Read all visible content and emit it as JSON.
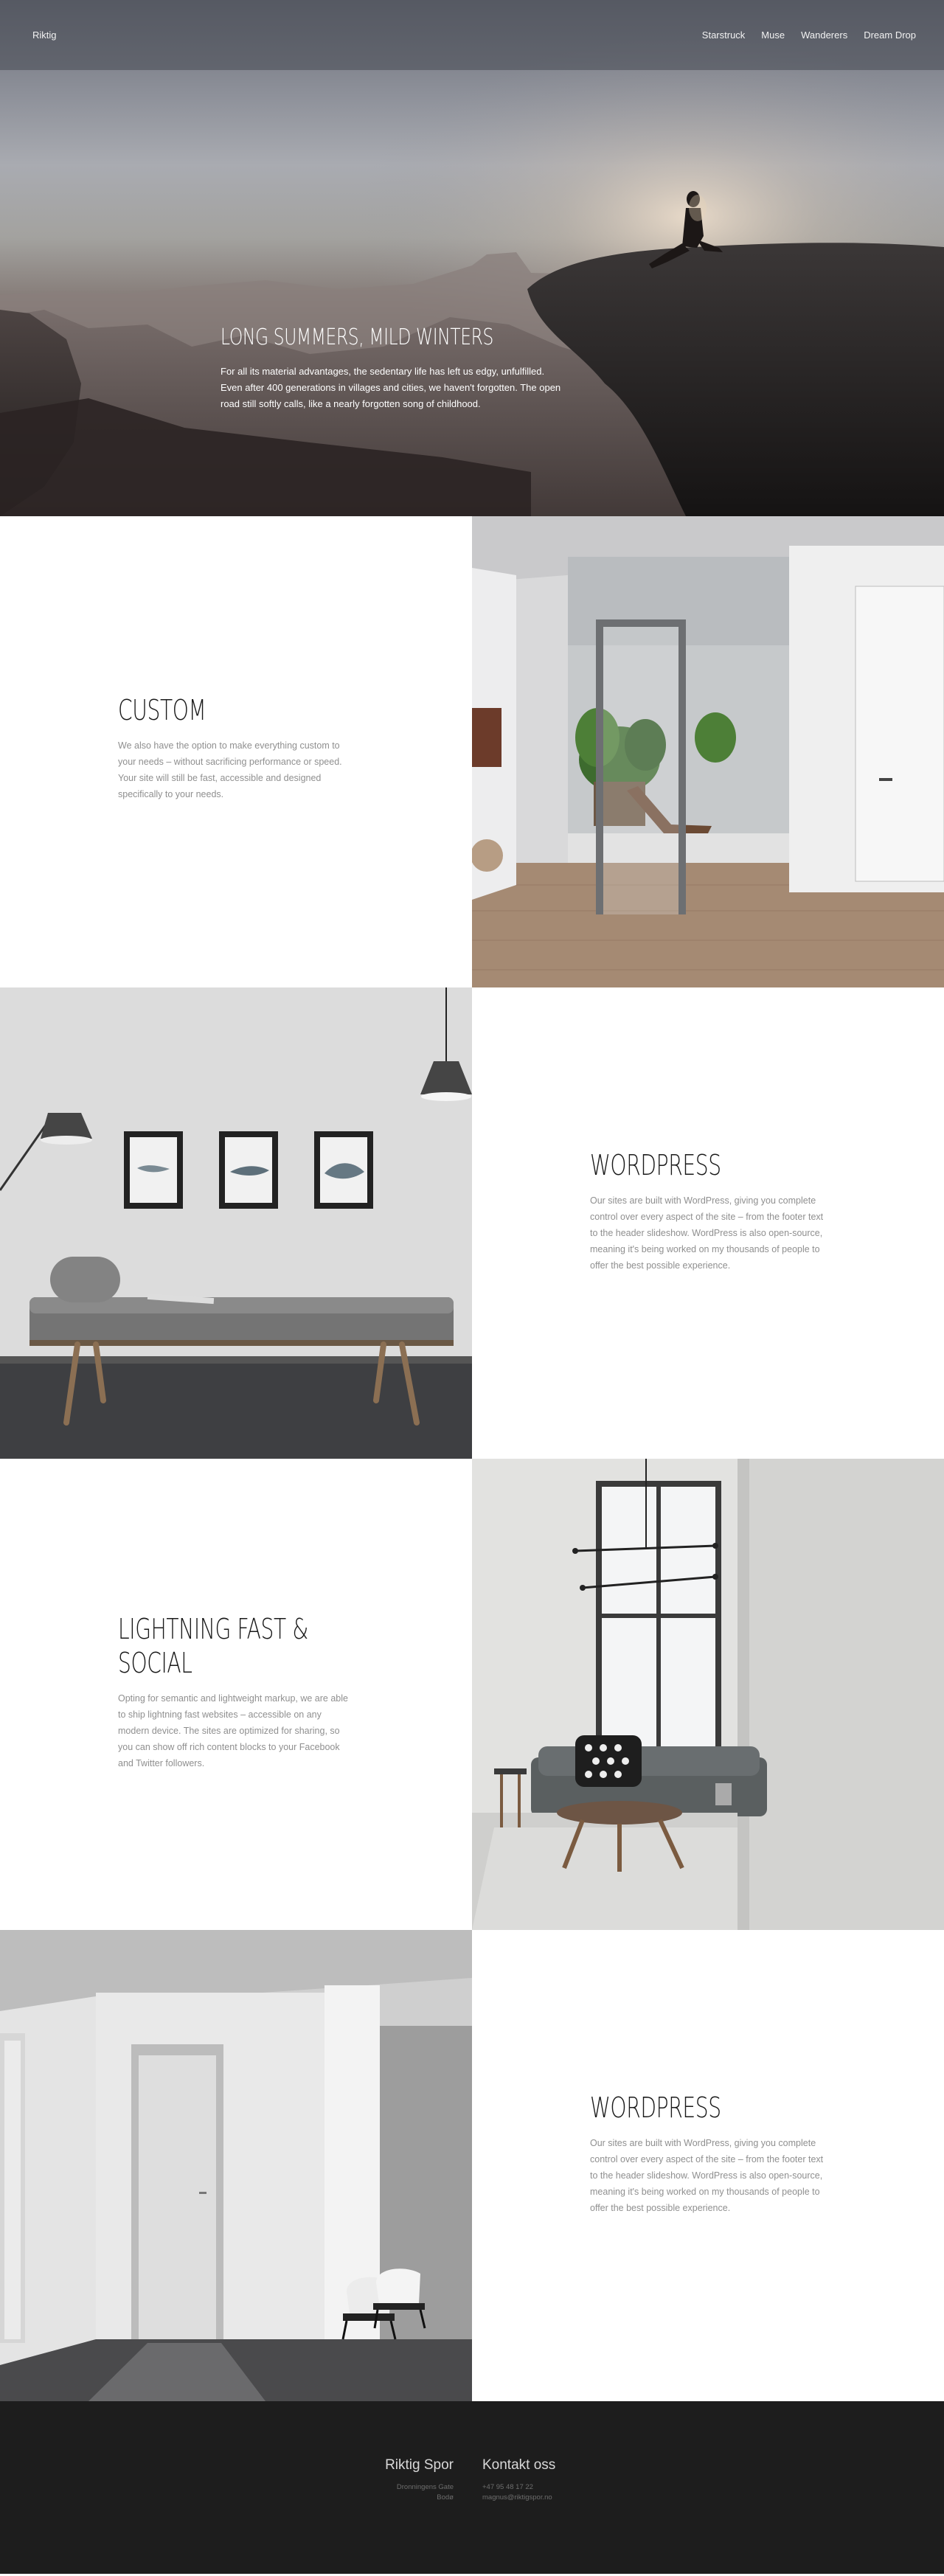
{
  "header": {
    "brand": "Riktig",
    "nav": [
      "Starstruck",
      "Muse",
      "Wanderers",
      "Dream Drop"
    ]
  },
  "hero": {
    "title": "LONG SUMMERS, MILD WINTERS",
    "body": "For all its material advantages, the sedentary life has left us edgy, unfulfilled. Even after 400 generations in villages and cities, we haven't forgotten. The open road still softly calls, like a nearly forgotten song of childhood."
  },
  "features": [
    {
      "title": "CUSTOM",
      "body": "We also have the option to make everything custom to your needs – without sacrificing performance or speed. Your site will still be fast, accessible and designed specifically to your needs."
    },
    {
      "title": "WORDPRESS",
      "body": "Our sites are built with WordPress, giving you complete control over every aspect of the site – from the footer text to the header slideshow. WordPress is also open-source, meaning it's being worked on my thousands of people to offer the best possible experience."
    },
    {
      "title": "LIGHTNING FAST & SOCIAL",
      "body": "Opting for semantic and lightweight markup, we are able to ship lightning fast websites – accessible on any modern device. The sites are optimized for sharing, so you can show off rich content blocks to your Facebook and Twitter followers."
    },
    {
      "title": "WORDPRESS",
      "body": "Our sites are built with WordPress, giving you complete control over every aspect of the site – from the footer text to the header slideshow. WordPress is also open-source, meaning it's being worked on my thousands of people to offer the best possible experience."
    }
  ],
  "footer": {
    "company": {
      "heading": "Riktig Spor",
      "lines": [
        "Dronningens Gate",
        "Bodø"
      ]
    },
    "contact": {
      "heading": "Kontakt oss",
      "lines": [
        "+47 95 48 17 22",
        "magnus@riktigspor.no"
      ]
    }
  }
}
